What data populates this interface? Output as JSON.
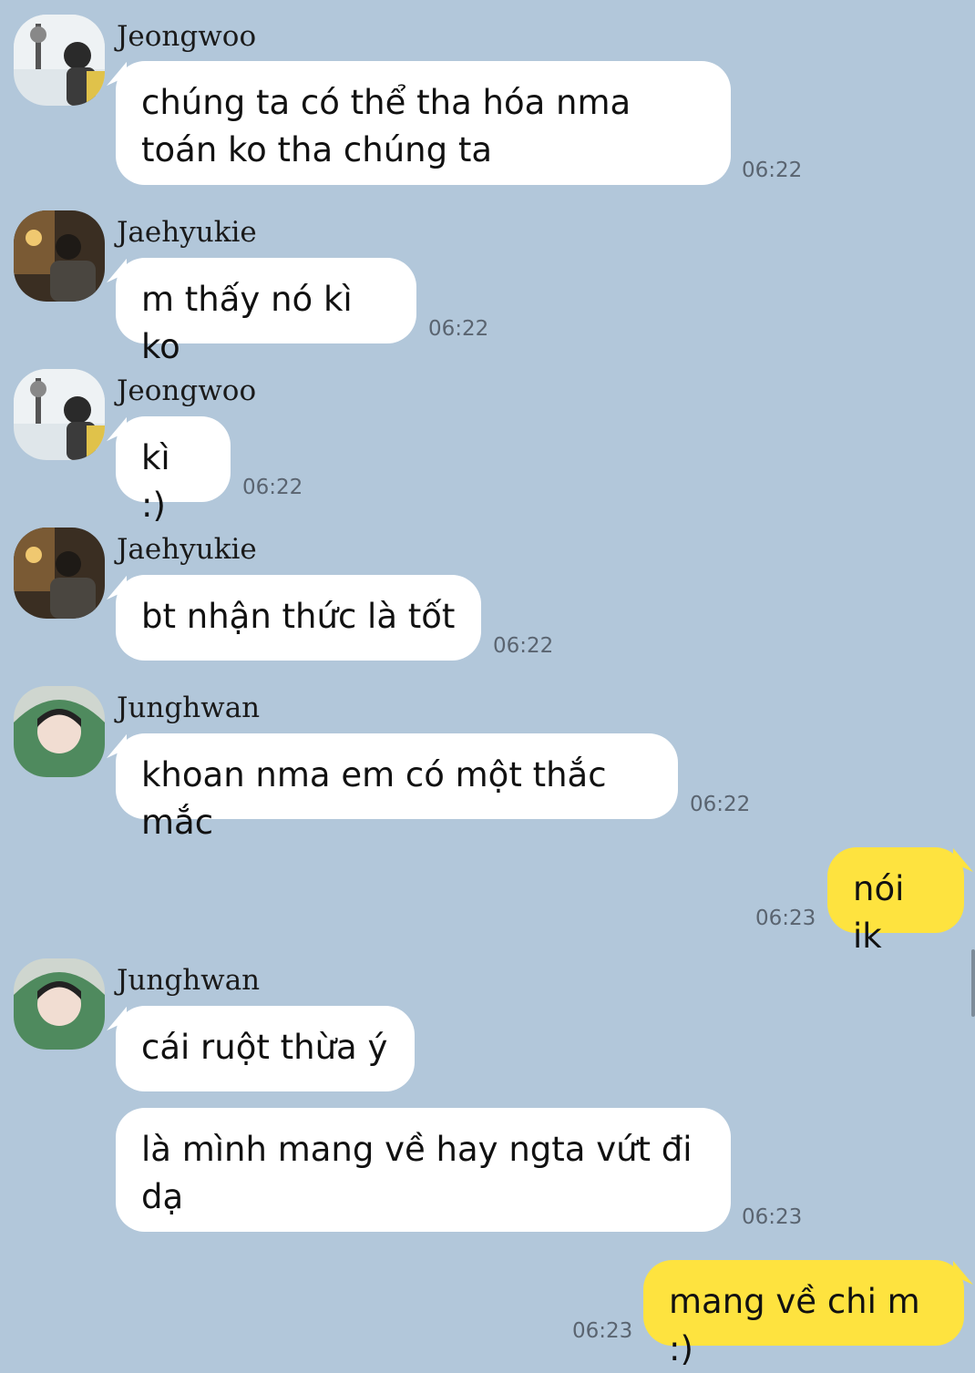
{
  "messages": [
    {
      "sender": "Jeongwoo",
      "text": "chúng ta có thể tha hóa nma toán ko tha chúng ta",
      "time": "06:22"
    },
    {
      "sender": "Jaehyukie",
      "text": "m thấy nó kì ko",
      "time": "06:22"
    },
    {
      "sender": "Jeongwoo",
      "text": "kì :)",
      "time": "06:22"
    },
    {
      "sender": "Jaehyukie",
      "text": "bt nhận thức là tốt",
      "time": "06:22"
    },
    {
      "sender": "Junghwan",
      "text": "khoan nma em có một thắc mắc",
      "time": "06:22"
    },
    {
      "sender": "me",
      "text": "nói ik",
      "time": "06:23"
    },
    {
      "sender": "Junghwan",
      "text": "cái ruột thừa ý",
      "time": ""
    },
    {
      "sender": "Junghwan",
      "text": "là mình mang về hay ngta vứt đi dạ",
      "time": "06:23"
    },
    {
      "sender": "me",
      "text": "mang về chi m :)",
      "time": "06:23"
    }
  ],
  "colors": {
    "background": "#b2c7da",
    "incoming_bubble": "#ffffff",
    "outgoing_bubble": "#fee33f"
  }
}
